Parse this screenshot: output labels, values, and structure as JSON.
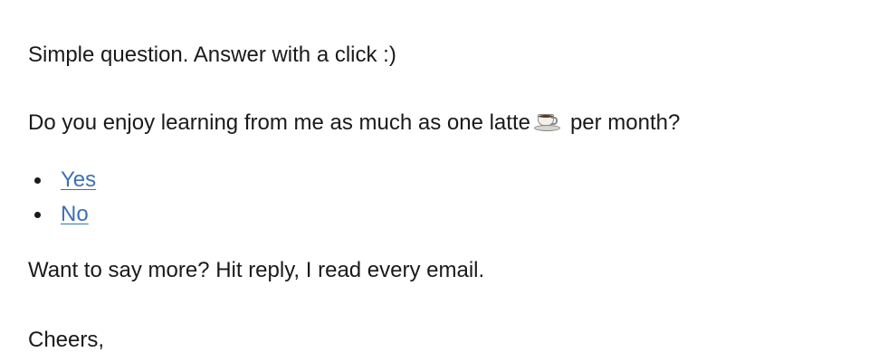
{
  "email": {
    "intro": "Simple question. Answer with a click :)",
    "question": {
      "before": "Do you enjoy learning from me as much as one latte",
      "icon": "coffee-cup-icon",
      "after": "per month?"
    },
    "options": [
      {
        "label": "Yes"
      },
      {
        "label": "No"
      }
    ],
    "more": "Want to say more? Hit reply, I read every email.",
    "signoff": "Cheers,"
  },
  "colors": {
    "text": "#1a1a1a",
    "link": "#3c70b5",
    "background": "#ffffff"
  }
}
